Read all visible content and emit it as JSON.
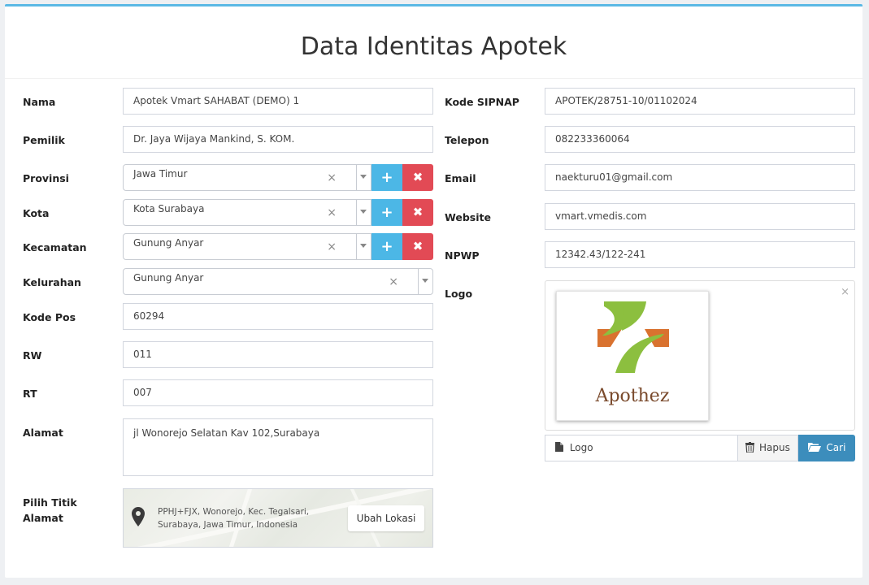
{
  "page": {
    "title": "Data Identitas Apotek"
  },
  "left": {
    "nama": {
      "label": "Nama",
      "value": "Apotek Vmart SAHABAT (DEMO) 1"
    },
    "pemilik": {
      "label": "Pemilik",
      "value": "Dr. Jaya Wijaya Mankind, S. KOM."
    },
    "provinsi": {
      "label": "Provinsi",
      "value": "Jawa Timur"
    },
    "kota": {
      "label": "Kota",
      "value": "Kota Surabaya"
    },
    "kecamatan": {
      "label": "Kecamatan",
      "value": "Gunung Anyar"
    },
    "kelurahan": {
      "label": "Kelurahan",
      "value": "Gunung Anyar"
    },
    "kodepos": {
      "label": "Kode Pos",
      "value": "60294"
    },
    "rw": {
      "label": "RW",
      "value": "011"
    },
    "rt": {
      "label": "RT",
      "value": "007"
    },
    "alamat": {
      "label": "Alamat",
      "value": "jl Wonorejo Selatan Kav 102,Surabaya"
    },
    "titik": {
      "label_line1": "Pilih Titik",
      "label_line2": "Alamat",
      "address": "PPHJ+FJX, Wonorejo, Kec. Tegalsari, Surabaya, Jawa Timur, Indonesia",
      "button": "Ubah Lokasi"
    }
  },
  "right": {
    "sipnap": {
      "label": "Kode SIPNAP",
      "value": "APOTEK/28751-10/01102024"
    },
    "telepon": {
      "label": "Telepon",
      "value": "082233360064"
    },
    "email": {
      "label": "Email",
      "value": "naekturu01@gmail.com"
    },
    "website": {
      "label": "Website",
      "value": "vmart.vmedis.com"
    },
    "npwp": {
      "label": "NPWP",
      "value": "12342.43/122-241"
    },
    "logo": {
      "label": "Logo",
      "brand": "Apothez",
      "file_name": "Logo",
      "hapus": "Hapus",
      "cari": "Cari"
    }
  },
  "icons": {
    "clear": "×",
    "add": "+",
    "remove": "✖",
    "trash": "trash-icon",
    "folder": "folder-open-icon",
    "file": "file-icon",
    "pin": "map-pin-icon"
  },
  "colors": {
    "accent_top": "#5bb9e5",
    "add_button": "#4cb7e6",
    "remove_button": "#e24a55",
    "cari_button": "#3c8dbc",
    "logo_green": "#8cbf3f",
    "logo_orange": "#d9722f"
  }
}
